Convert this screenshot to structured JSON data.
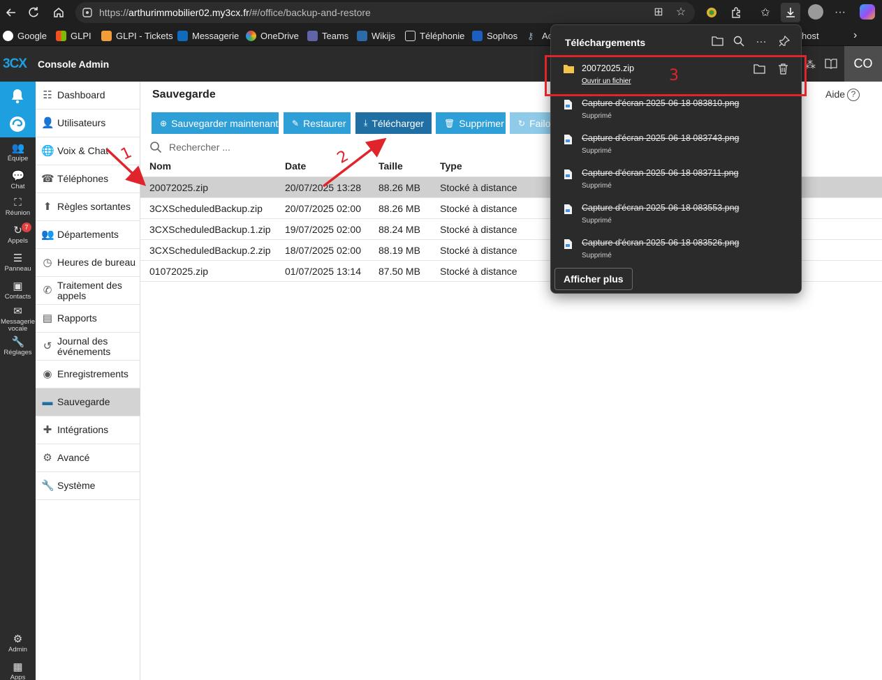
{
  "browser": {
    "url_prefix": "https://",
    "url_host": "arthurimmobilier02.my3cx.fr",
    "url_path": "/#/office/backup-and-restore",
    "bookmarks": [
      "Google",
      "GLPI",
      "GLPI - Tickets",
      "Messagerie",
      "OneDrive",
      "Teams",
      "Wikijs",
      "Téléphonie",
      "Sophos",
      "Ac",
      "host"
    ]
  },
  "app": {
    "logo": "3CX",
    "title": "Console Admin",
    "user_initials": "CO"
  },
  "rail": {
    "items": [
      "Équipe",
      "Chat",
      "Réunion",
      "Appels",
      "Panneau",
      "Contacts",
      "Messagerie vocale",
      "Réglages",
      "Admin",
      "Apps"
    ],
    "missed_calls_badge": "7"
  },
  "sidebar": {
    "items": [
      "Dashboard",
      "Utilisateurs",
      "Voix & Chat",
      "Téléphones",
      "Règles sortantes",
      "Départements",
      "Heures de bureau",
      "Traitement des appels",
      "Rapports",
      "Journal des événements",
      "Enregistrements",
      "Sauvegarde",
      "Intégrations",
      "Avancé",
      "Système"
    ],
    "active": "Sauvegarde"
  },
  "main": {
    "title": "Sauvegarde",
    "help": "Aide",
    "buttons": {
      "backup_now": "Sauvegarder maintenant",
      "restore": "Restaurer",
      "download": "Télécharger",
      "delete": "Supprimer",
      "failover": "Failo"
    },
    "search_placeholder": "Rechercher ...",
    "columns": [
      "Nom",
      "Date",
      "Taille",
      "Type"
    ],
    "rows": [
      {
        "name": "20072025.zip",
        "date": "20/07/2025 13:28",
        "size": "88.26 MB",
        "type": "Stocké à distance",
        "selected": true
      },
      {
        "name": "3CXScheduledBackup.zip",
        "date": "20/07/2025 02:00",
        "size": "88.26 MB",
        "type": "Stocké à distance"
      },
      {
        "name": "3CXScheduledBackup.1.zip",
        "date": "19/07/2025 02:00",
        "size": "88.24 MB",
        "type": "Stocké à distance"
      },
      {
        "name": "3CXScheduledBackup.2.zip",
        "date": "18/07/2025 02:00",
        "size": "88.19 MB",
        "type": "Stocké à distance"
      },
      {
        "name": "01072025.zip",
        "date": "01/07/2025 13:14",
        "size": "87.50 MB",
        "type": "Stocké à distance"
      }
    ]
  },
  "downloads": {
    "title": "Téléchargements",
    "items": [
      {
        "name": "20072025.zip",
        "sub": "Ouvrir un fichier",
        "deleted": false
      },
      {
        "name": "Capture d'écran 2025-06-18 083810.png",
        "sub": "Supprimé",
        "deleted": true
      },
      {
        "name": "Capture d'écran 2025-06-18 083743.png",
        "sub": "Supprimé",
        "deleted": true
      },
      {
        "name": "Capture d'écran 2025-06-18 083711.png",
        "sub": "Supprimé",
        "deleted": true
      },
      {
        "name": "Capture d'écran 2025-06-18 083553.png",
        "sub": "Supprimé",
        "deleted": true
      },
      {
        "name": "Capture d'écran 2025-06-18 083526.png",
        "sub": "Supprimé",
        "deleted": true
      }
    ],
    "show_more": "Afficher plus"
  },
  "annotations": {
    "labels": [
      "1",
      "2",
      "3"
    ],
    "color": "#e0242b"
  }
}
